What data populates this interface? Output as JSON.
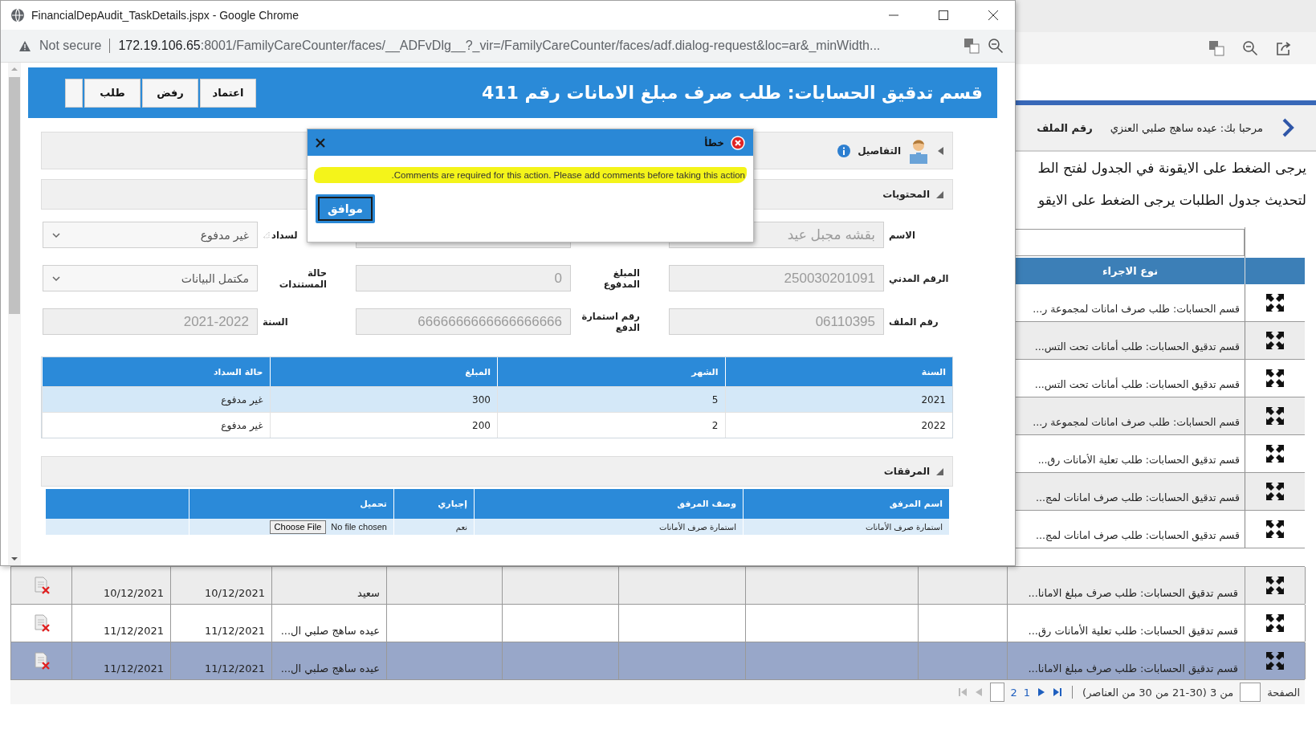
{
  "popup_window": {
    "title": "FinancialDepAudit_TaskDetails.jspx - Google Chrome",
    "address_bar": {
      "security": "Not secure",
      "host": "172.19.106.65",
      "path": ":8001/FamilyCareCounter/faces/__ADFvDlg__?_vir=/FamilyCareCounter/faces/adf.dialog-request&loc=ar&_minWidth..."
    },
    "header": {
      "title": "قسم تدقيق الحسابات: طلب صرف مبلغ الامانات رقم 411",
      "buttons": [
        {
          "label": "اعتماد"
        },
        {
          "label": "رفض"
        },
        {
          "label": "طلب"
        }
      ]
    },
    "details_section": {
      "title": "التفاصيل",
      "expanded": false
    },
    "contents_section": {
      "title": "المحتويات",
      "expanded": true
    },
    "form_columns": [
      [
        {
          "kind": "text",
          "label": "الاسم",
          "value": "بقشه مجبل عيد"
        },
        {
          "kind": "text",
          "label": "الرقم المدني",
          "value": "250030201091"
        },
        {
          "kind": "text",
          "label": "رقم الملف",
          "value": "06110395"
        }
      ],
      [
        {
          "kind": "text"
        },
        {
          "kind": "text",
          "label": "المبلغ المدفوع",
          "value": "0"
        },
        {
          "kind": "text",
          "label": "رقم استمارة الدفع",
          "value": "6666666666666666666"
        }
      ],
      [
        {
          "kind": "select",
          "label": "لسداد",
          "value": "غير مدفوع"
        },
        {
          "kind": "select",
          "label": "حالة المستندات",
          "value": "مكتمل البيانات"
        },
        {
          "kind": "text",
          "label": "السنة",
          "value": "2021-2022"
        }
      ]
    ],
    "payments_table": {
      "columns": [
        "السنة",
        "الشهر",
        "المبلغ",
        "حالة السداد"
      ],
      "rows": [
        {
          "cells": [
            "2021",
            "5",
            "300",
            "غير مدفوع"
          ],
          "selected": true
        },
        {
          "cells": [
            "2022",
            "2",
            "200",
            "غير مدفوع"
          ],
          "selected": false
        }
      ]
    },
    "attachments_section": {
      "title": "المرفقات",
      "expanded": true
    },
    "attachments_table": {
      "columns": [
        "اسم المرفق",
        "وصف المرفق",
        "إجباري",
        "تحميل"
      ],
      "rows": [
        {
          "name": "استمارة صرف الأمانات",
          "description": "استمارة صرف الأمانات",
          "required": "نعم",
          "file_status": "No file chosen",
          "file_button": "Choose File"
        }
      ]
    }
  },
  "error_dialog": {
    "title": "خطأ",
    "message": "Comments are required for this action. Please add comments before taking this action.",
    "button": "موافق"
  },
  "background_page": {
    "welcome": "مرحبا بك: عيده ساهج صلبي العنزي",
    "file_number_label": "رقم الملف",
    "instructions": [
      "يرجى الضغط على الايقونة في الجدول لفتح الط",
      "لتحديث جدول الطلبات يرجى الضغط على الايقو"
    ],
    "requests_table": {
      "columns": [
        "نوع الاجراء"
      ],
      "rows": [
        {
          "action_type": "قسم الحسابات: طلب صرف امانات لمجموعة ر...",
          "selected": false
        },
        {
          "action_type": "قسم تدقيق الحسابات: طلب أمانات تحت التس...",
          "selected": false
        },
        {
          "action_type": "قسم تدقيق الحسابات: طلب أمانات تحت التس...",
          "selected": false
        },
        {
          "action_type": "قسم الحسابات: طلب صرف امانات لمجموعة ر...",
          "selected": false
        },
        {
          "action_type": "قسم تدقيق الحسابات: طلب تعلية الأمانات رق...",
          "selected": false
        },
        {
          "action_type": "قسم تدقيق الحسابات: طلب صرف امانات لمج...",
          "selected": false
        },
        {
          "action_type": "قسم تدقيق الحسابات: طلب صرف امانات لمج...",
          "selected": false
        },
        {
          "action_type": "قسم تدقيق الحسابات: طلب صرف مبلغ الامانا...",
          "column_8": "سعيد",
          "column_9": "10/12/2021",
          "column_10": "10/12/2021",
          "selected": false
        },
        {
          "action_type": "قسم تدقيق الحسابات: طلب تعلية الأمانات رق...",
          "column_8": "عيده ساهج صلبي ال...",
          "column_9": "11/12/2021",
          "column_10": "11/12/2021",
          "selected": false
        },
        {
          "action_type": "قسم تدقيق الحسابات: طلب صرف مبلغ الامانا...",
          "column_8": "عيده ساهج صلبي ال...",
          "column_9": "11/12/2021",
          "column_10": "11/12/2021",
          "selected": true
        }
      ]
    },
    "pager": {
      "page_label": "الصفحة",
      "summary": "من 3 (30-21 من 30 من العناصر)",
      "pages": [
        "1",
        "2"
      ],
      "nav": [
        {
          "kind": "first",
          "disabled": false
        },
        {
          "kind": "previous",
          "disabled": false
        },
        {
          "kind": "next",
          "disabled": true
        },
        {
          "kind": "last",
          "disabled": true
        }
      ]
    }
  }
}
